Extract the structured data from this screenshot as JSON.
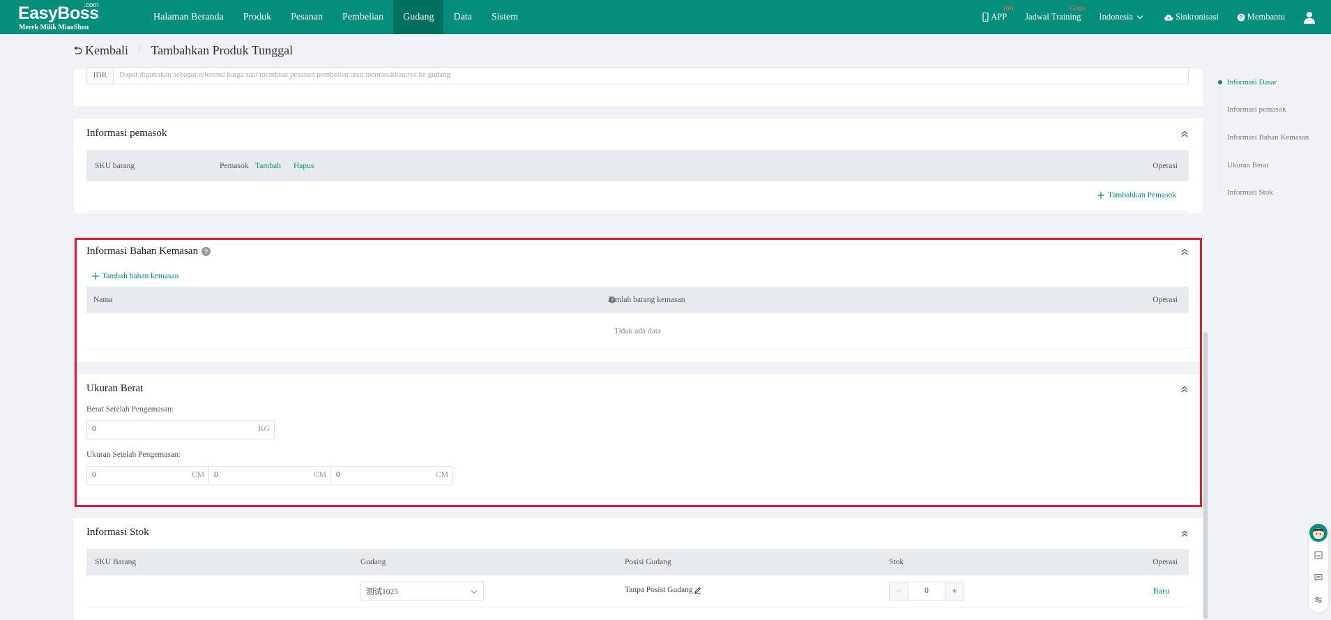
{
  "app": {
    "logo_main": "EasyBoss",
    "logo_com": ".com",
    "logo_sub": "Merek Milik MiaoShou",
    "brand_color": "#038f7b"
  },
  "nav": {
    "items": [
      {
        "label": "Halaman Beranda"
      },
      {
        "label": "Produk"
      },
      {
        "label": "Pesanan"
      },
      {
        "label": "Pembelian"
      },
      {
        "label": "Gudang"
      },
      {
        "label": "Data"
      },
      {
        "label": "Sistem"
      }
    ],
    "active": "Gudang",
    "app_label": "APP",
    "app_badge": "H01",
    "training_label": "Jadwal Training",
    "training_badge": "Gratis",
    "language": "Indonesia",
    "sync_label": "Sinkronisasi",
    "help_label": "Membantu"
  },
  "breadcrumb": {
    "back": "Kembali",
    "separator": "/",
    "current": "Tambahkan Produk Tunggal"
  },
  "price_section": {
    "currency": "IDR",
    "placeholder": "Dapat digunakan sebagai referensi harga saat membuat pesanan pembelian atau memasukkannya ke gudang"
  },
  "supplier": {
    "title": "Informasi pemasok",
    "col_sku": "SKU barang",
    "col_supplier": "Pemasok",
    "add_link": "Tambah",
    "delete_link": "Hapus",
    "col_operation": "Operasi",
    "add_supplier": "Tambahkan Pemasok"
  },
  "packaging": {
    "title": "Informasi Bahan Kemasan",
    "add_link": "Tambah bahan kemasan",
    "col_name": "Nama",
    "col_qty": "Jumlah barang kemasan",
    "col_operation": "Operasi",
    "empty": "Tidak ada data"
  },
  "weight": {
    "title": "Ukuran Berat",
    "weight_label": "Berat Setelah Pengemasan:",
    "weight_value": "0",
    "weight_unit": "KG",
    "size_label": "Ukuran Setelah Pengemasan:",
    "size_values": [
      "0",
      "0",
      "0"
    ],
    "size_unit": "CM"
  },
  "stock": {
    "title": "Informasi Stok",
    "col_sku": "SKU Barang",
    "col_warehouse": "Gudang",
    "col_position": "Posisi Gudang",
    "col_stock": "Stok",
    "col_operation": "Operasi",
    "row": {
      "warehouse": "测试1025",
      "position": "Tanpa Posisi Gudang",
      "stock": "0",
      "operation": "Baru"
    }
  },
  "anchor": {
    "items": [
      "Informasi Dasar",
      "Informasi pemasok",
      "Informasi Bahan Kemasan",
      "Ukuran Berat",
      "Informasi Stok"
    ],
    "active": "Informasi Dasar"
  },
  "highlight_color": "#e8192c"
}
